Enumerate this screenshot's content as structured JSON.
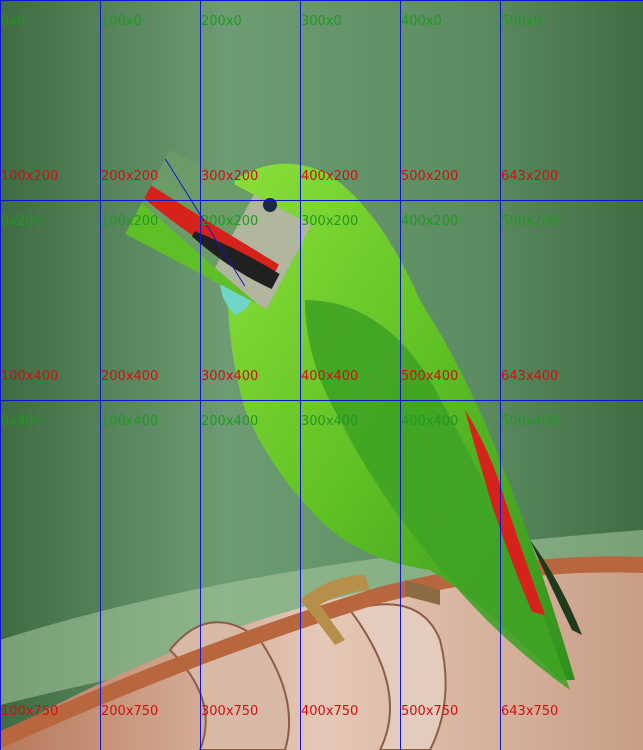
{
  "grid": {
    "top_labels": [
      [
        "0x0",
        "100x0",
        "200x0",
        "300x0",
        "400x0",
        "500x0"
      ],
      [
        "0x200",
        "100x200",
        "200x200",
        "300x200",
        "400x200",
        "500x200"
      ],
      [
        "0x400",
        "100x400",
        "200x400",
        "300x400",
        "400x400",
        "500x400"
      ]
    ],
    "bottom_labels": [
      [
        "100x200",
        "200x200",
        "300x200",
        "400x200",
        "500x200",
        "643x200"
      ],
      [
        "100x400",
        "200x400",
        "300x400",
        "400x400",
        "500x400",
        "643x400"
      ],
      [
        "100x750",
        "200x750",
        "300x750",
        "400x750",
        "500x750",
        "643x750"
      ]
    ]
  },
  "colors": {
    "background_green": "#4f7f4f",
    "bird_green": "#6fcb2a",
    "bird_red": "#d5221a",
    "grid_line": "#1515c8",
    "label_green": "#1f9a1f",
    "label_red": "#d21010"
  }
}
